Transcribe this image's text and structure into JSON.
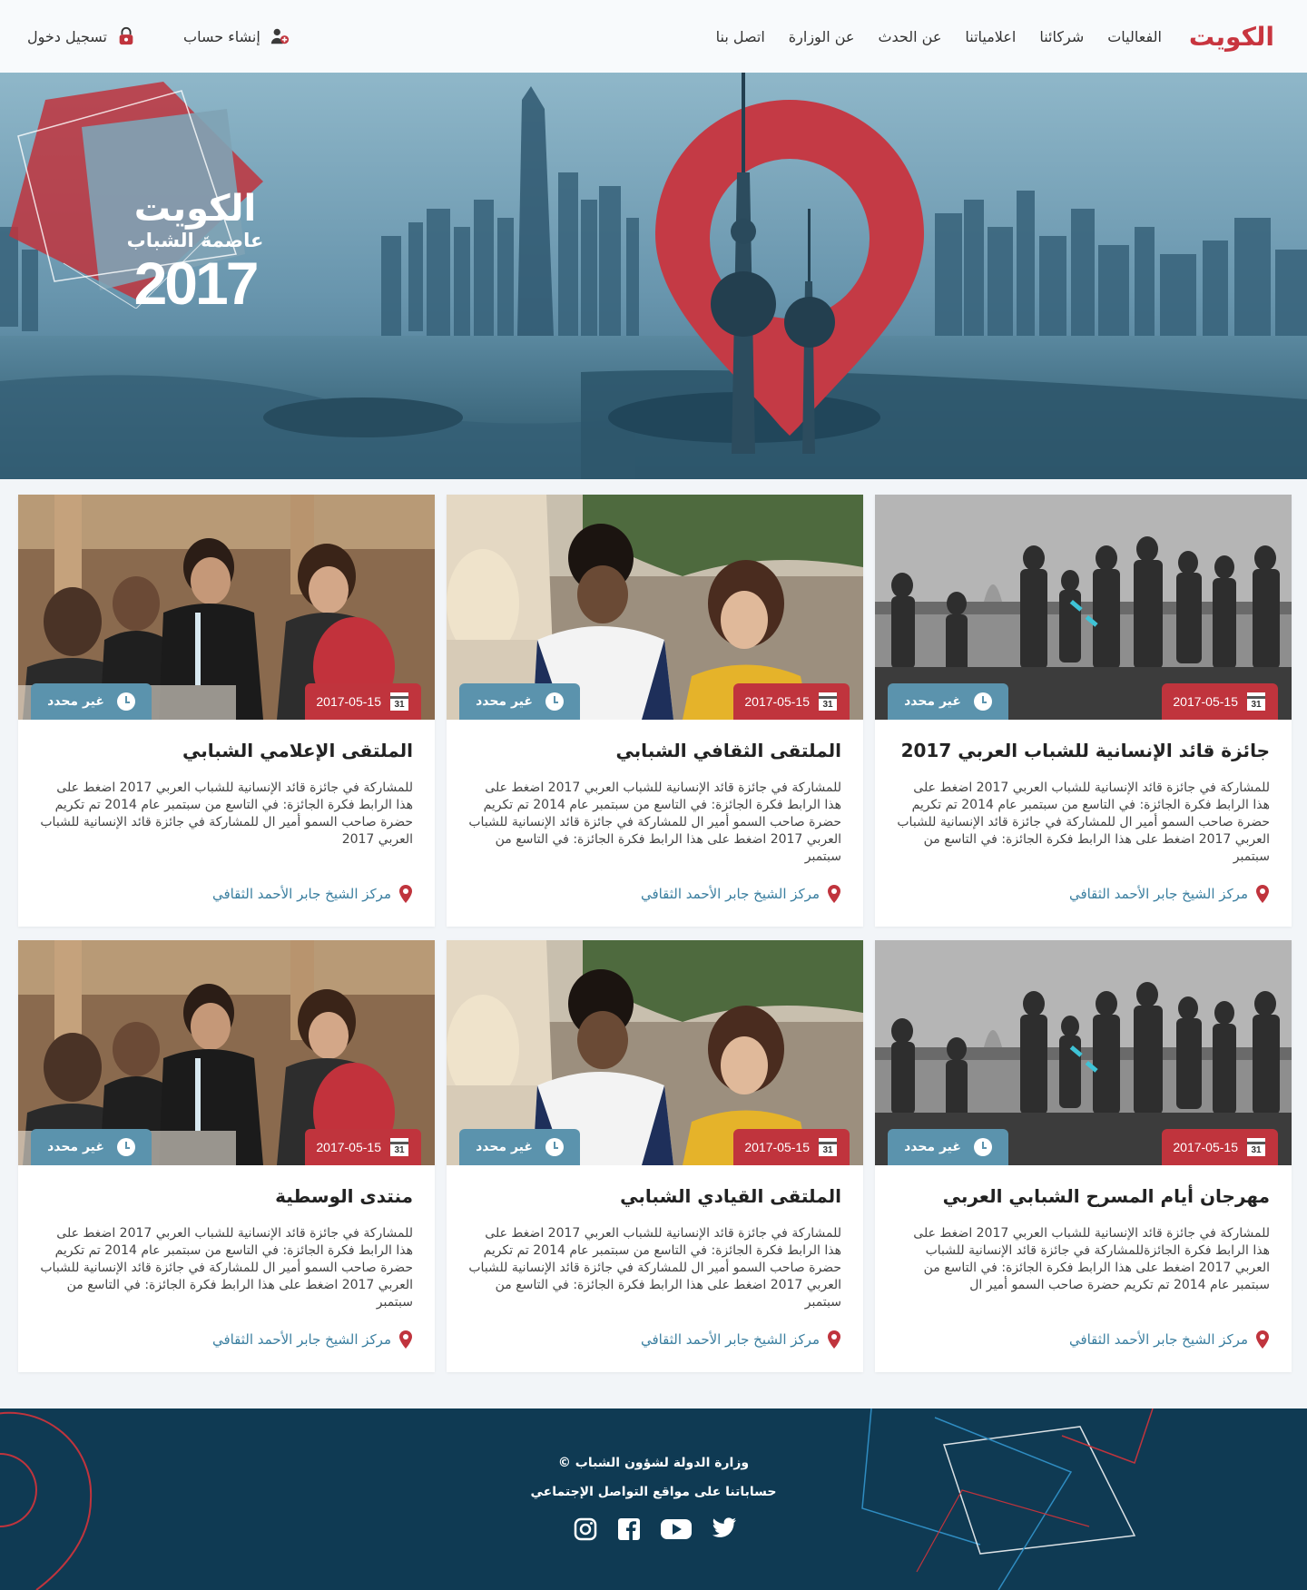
{
  "header": {
    "logo": "الكويت",
    "nav": [
      "الفعاليات",
      "شركائنا",
      "اعلامياتنا",
      "عن الحدث",
      "عن الوزارة",
      "اتصل بنا"
    ],
    "register_label": "إنشاء حساب",
    "login_label": "تسجيل دخول"
  },
  "hero": {
    "title": "الكويت",
    "subtitle": "عاصمة الشباب",
    "year": "2017"
  },
  "cards": [
    {
      "title": "جائزة قائد الإنسانية للشباب العربي 2017",
      "date": "2017-05-15",
      "time": "غير محدد",
      "description": "للمشاركة في جائزة قائد الإنسانية للشباب العربي 2017 اضغط على هذا الرابط فكرة الجائزة: في التاسع من سبتمبر عام 2014 تم تكريم حضرة صاحب السمو أمير ال للمشاركة في جائزة قائد الإنسانية للشباب العربي 2017 اضغط على هذا الرابط فكرة الجائزة: في التاسع من سبتمبر",
      "location": "مركز الشيخ جابر الأحمد الثقافي",
      "image": "gray-crowd"
    },
    {
      "title": "الملتقى الثقافي الشبابي",
      "date": "2017-05-15",
      "time": "غير محدد",
      "description": "للمشاركة في جائزة قائد الإنسانية للشباب العربي 2017 اضغط على هذا الرابط فكرة الجائزة: في التاسع من سبتمبر عام 2014 تم تكريم حضرة صاحب السمو أمير ال للمشاركة في جائزة قائد الإنسانية للشباب العربي 2017 اضغط على هذا الرابط فكرة الجائزة: في التاسع من سبتمبر",
      "location": "مركز الشيخ جابر الأحمد الثقافي",
      "image": "friends"
    },
    {
      "title": "الملتقى الإعلامي الشبابي",
      "date": "2017-05-15",
      "time": "غير محدد",
      "description": "للمشاركة في جائزة قائد الإنسانية للشباب العربي 2017 اضغط على هذا الرابط فكرة الجائزة: في التاسع من سبتمبر عام 2014 تم تكريم حضرة صاحب السمو أمير ال للمشاركة في جائزة قائد الإنسانية للشباب العربي 2017",
      "location": "مركز الشيخ جابر الأحمد الثقافي",
      "image": "conference"
    },
    {
      "title": "مهرجان أيام المسرح الشبابي العربي",
      "date": "2017-05-15",
      "time": "غير محدد",
      "description": "للمشاركة في جائزة قائد الإنسانية للشباب العربي 2017 اضغط على هذا الرابط فكرة الجائزةللمشاركة في جائزة قائد الإنسانية للشباب العربي 2017 اضغط على هذا الرابط فكرة الجائزة: في التاسع من سبتمبر عام 2014 تم تكريم حضرة صاحب السمو أمير ال",
      "location": "مركز الشيخ جابر الأحمد الثقافي",
      "image": "gray-crowd"
    },
    {
      "title": "الملتقى القيادي الشبابي",
      "date": "2017-05-15",
      "time": "غير محدد",
      "description": "للمشاركة في جائزة قائد الإنسانية للشباب العربي 2017 اضغط على هذا الرابط فكرة الجائزة: في التاسع من سبتمبر عام 2014 تم تكريم حضرة صاحب السمو أمير ال للمشاركة في جائزة قائد الإنسانية للشباب العربي 2017 اضغط على هذا الرابط فكرة الجائزة: في التاسع من سبتمبر",
      "location": "مركز الشيخ جابر الأحمد الثقافي",
      "image": "friends"
    },
    {
      "title": "منتدى الوسطية",
      "date": "2017-05-15",
      "time": "غير محدد",
      "description": "للمشاركة في جائزة قائد الإنسانية للشباب العربي 2017 اضغط على هذا الرابط فكرة الجائزة: في التاسع من سبتمبر عام 2014 تم تكريم حضرة صاحب السمو أمير ال للمشاركة في جائزة قائد الإنسانية للشباب العربي 2017 اضغط على هذا الرابط فكرة الجائزة: في التاسع من سبتمبر",
      "location": "مركز الشيخ جابر الأحمد الثقافي",
      "image": "conference"
    }
  ],
  "footer": {
    "ministry": "وزارة الدولة لشؤون الشباب ©",
    "social_label": "حساباتنا على مواقع التواصل الإجتماعي",
    "socials": [
      "instagram-icon",
      "facebook-icon",
      "youtube-icon",
      "twitter-icon"
    ]
  },
  "colors": {
    "brand_red": "#c0343d",
    "accent_blue": "#5b93ad",
    "link_blue": "#3b7fa0",
    "footer_bg": "#0f3a53"
  }
}
